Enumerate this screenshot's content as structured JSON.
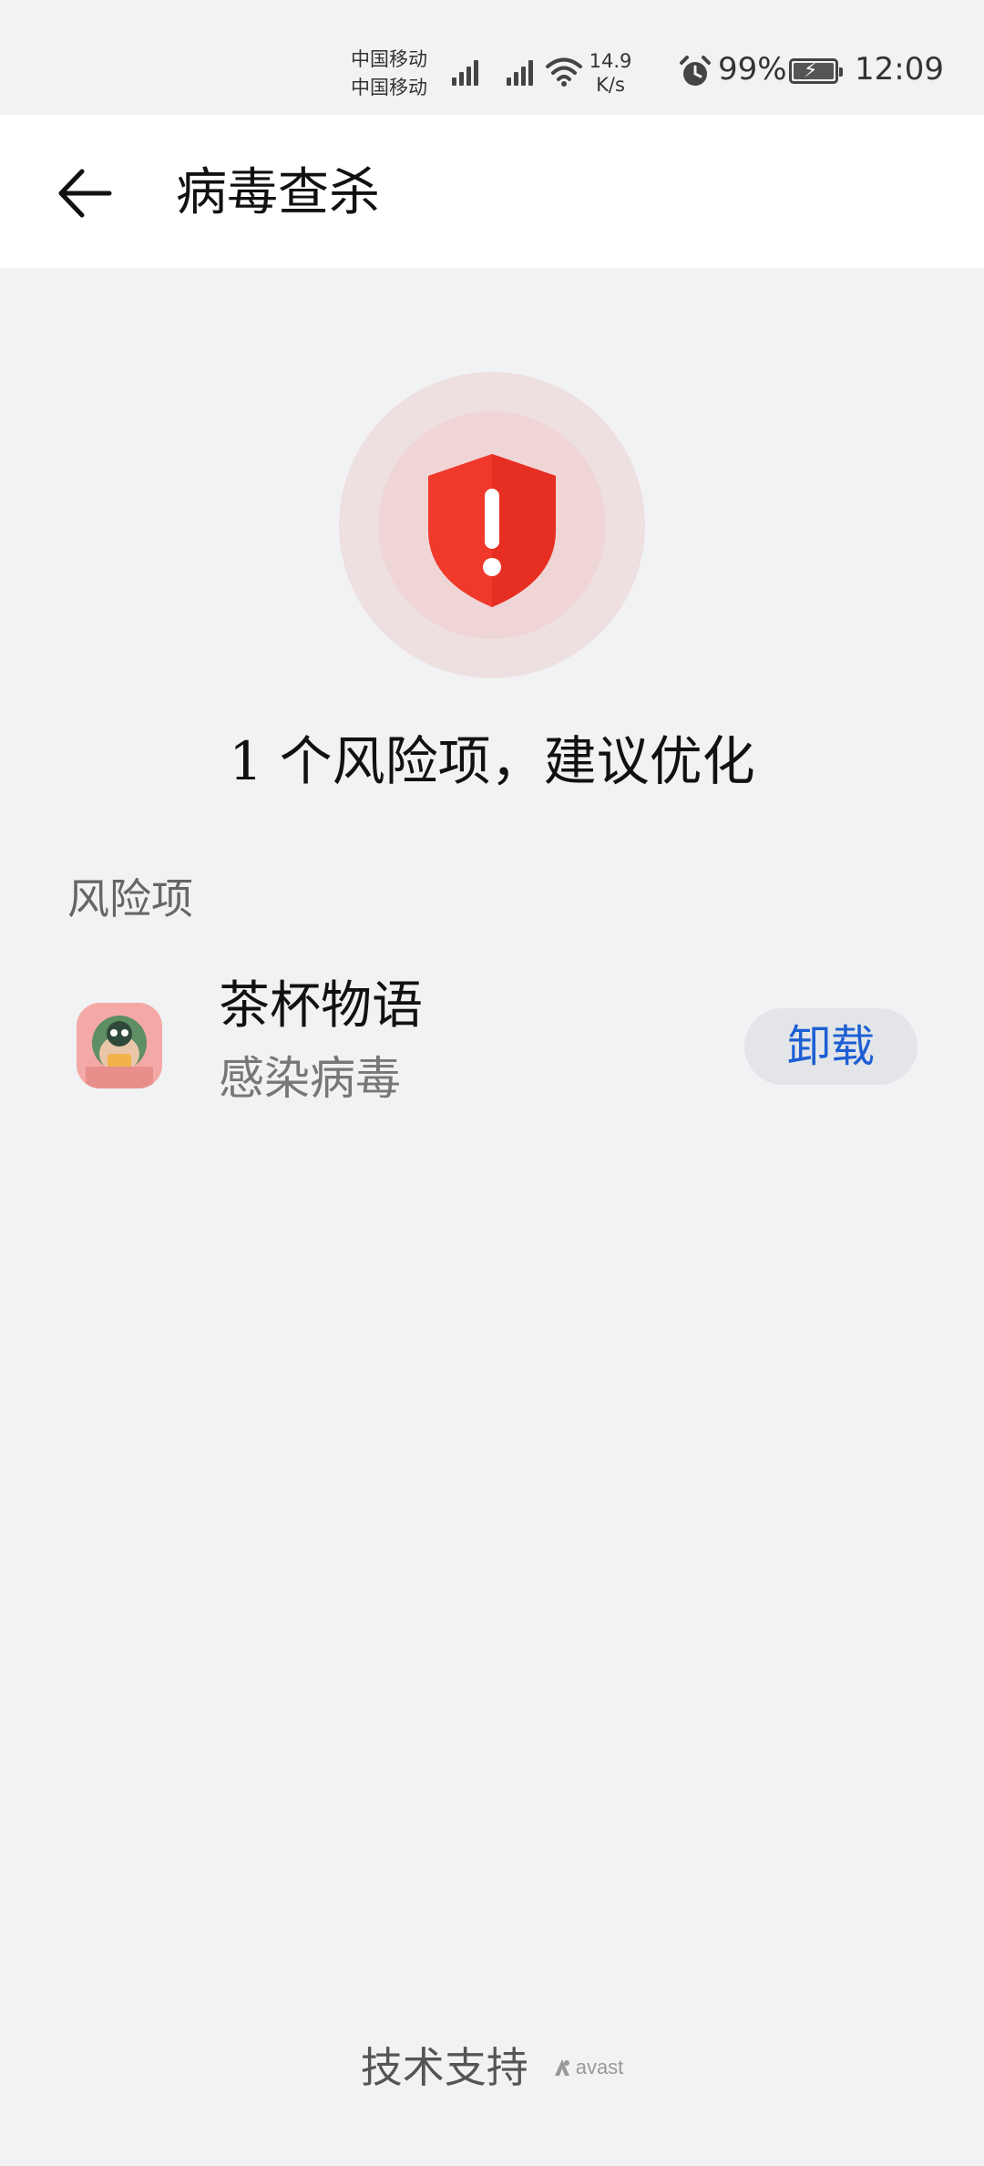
{
  "status_bar": {
    "carrier_1": "中国移动",
    "carrier_2": "中国移动",
    "net_speed_value": "14.9",
    "net_speed_unit": "K/s",
    "battery_percent": "99%",
    "time": "12:09",
    "icons": [
      "signal-icon",
      "signal-icon",
      "wifi-icon",
      "alarm-icon",
      "battery-charging-icon"
    ]
  },
  "app_bar": {
    "title": "病毒查杀",
    "back_icon": "back-arrow-icon"
  },
  "hero": {
    "icon": "shield-alert-icon",
    "summary": "1 个风险项，建议优化",
    "colors": {
      "shield": "#f0382b",
      "ring_outer": "#eedfe1",
      "ring_inner": "#f0d5d7"
    }
  },
  "risk_section": {
    "label": "风险项",
    "items": [
      {
        "app_name": "茶杯物语",
        "status": "感染病毒",
        "action_label": "卸载",
        "icon": "app-icon"
      }
    ]
  },
  "footer": {
    "support_label": "技术支持",
    "brand": "avast"
  },
  "colors": {
    "background": "#f1f2f4",
    "accent_blue": "#1c5fd4",
    "danger_red": "#f0382b"
  }
}
